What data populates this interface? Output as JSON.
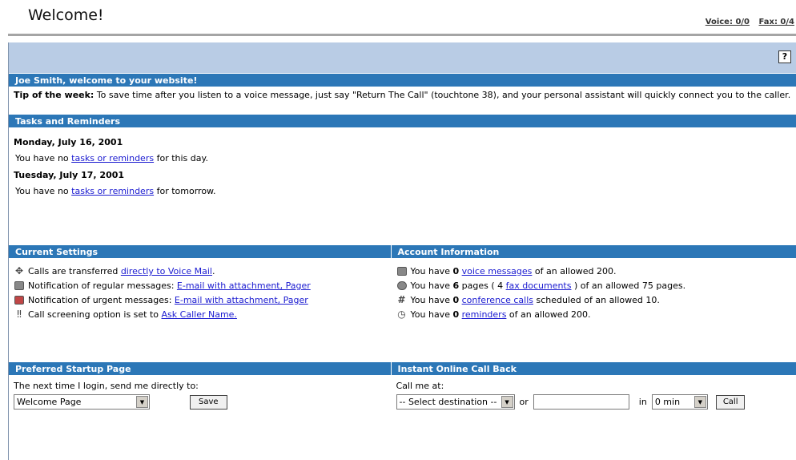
{
  "header": {
    "title": "Welcome!",
    "voice_label": "Voice: 0/0",
    "fax_label": "Fax: 0/4"
  },
  "help": {
    "label": "?"
  },
  "welcome": {
    "heading": "Joe Smith, welcome to your website!",
    "tip_label": "Tip of the week:",
    "tip_text": "To save time after you listen to a voice message, just say \"Return The Call\" (touchtone 38), and your personal assistant will quickly connect you to the caller."
  },
  "tasks": {
    "heading": "Tasks and Reminders",
    "days": [
      {
        "date": "Monday, July 16, 2001",
        "prefix": "You have no",
        "link": "tasks or reminders",
        "suffix": "for this day."
      },
      {
        "date": "Tuesday, July 17, 2001",
        "prefix": "You have no",
        "link": "tasks or reminders",
        "suffix": "for tomorrow."
      }
    ]
  },
  "settings": {
    "heading": "Current Settings",
    "items": [
      {
        "icon": "transfer-icon",
        "text": "Calls are transferred",
        "link": "directly to Voice Mail",
        "after": "."
      },
      {
        "icon": "envelope-icon",
        "text": "Notification of regular messages:",
        "link": "E-mail with attachment, Pager",
        "after": ""
      },
      {
        "icon": "urgent-envelope-icon",
        "text": "Notification of urgent messages:",
        "link": "E-mail with attachment, Pager",
        "after": ""
      },
      {
        "icon": "screening-icon",
        "text": "Call screening option is set to",
        "link": "Ask Caller Name.",
        "after": ""
      }
    ]
  },
  "account": {
    "heading": "Account Information",
    "items": [
      {
        "icon": "voicemail-icon",
        "prefix": "You have",
        "count": "0",
        "link": "voice messages",
        "suffix": "of an allowed 200."
      },
      {
        "icon": "fax-icon",
        "prefix": "You have",
        "count": "6",
        "mid": "pages ( 4",
        "link": "fax documents",
        "suffix": ") of an allowed 75 pages."
      },
      {
        "icon": "conference-icon",
        "prefix": "You have",
        "count": "0",
        "link": "conference calls",
        "suffix": "scheduled of an allowed 10."
      },
      {
        "icon": "clock-icon",
        "prefix": "You have",
        "count": "0",
        "link": "reminders",
        "suffix": "of an allowed 200."
      }
    ]
  },
  "startup": {
    "heading": "Preferred Startup Page",
    "prompt": "The next time I login, send me directly to:",
    "selected": "Welcome Page",
    "save_label": "Save"
  },
  "callback": {
    "heading": "Instant Online Call Back",
    "prompt": "Call me at:",
    "destination": "-- Select destination --",
    "or_label": "or",
    "in_label": "in",
    "delay": "0 min",
    "call_label": "Call"
  }
}
